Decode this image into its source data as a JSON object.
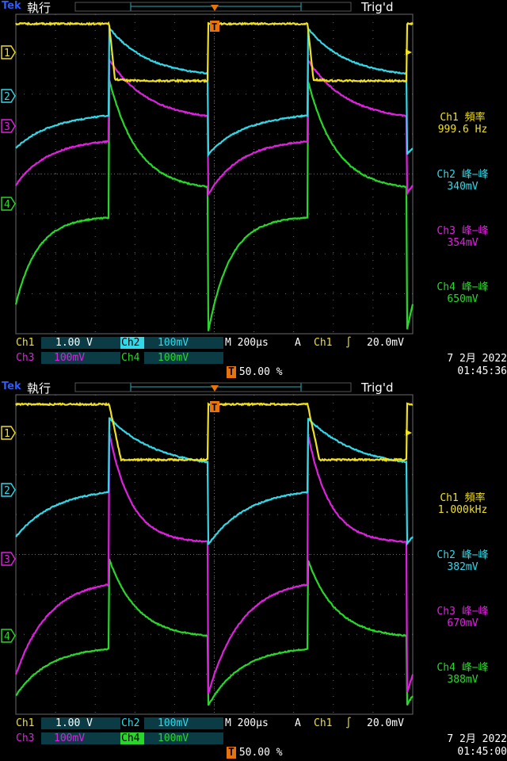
{
  "colors": {
    "ch1": "#f0e020",
    "ch2": "#30d8e8",
    "ch3": "#e020e0",
    "ch4": "#28d828",
    "grid": "#6a6a6a",
    "orange": "#e8720c"
  },
  "panels": [
    {
      "brand": "Tek",
      "run_state": "執行",
      "trigger_status": "Trig'd",
      "measurements": [
        {
          "label": "Ch1 頻率",
          "value": "999.6 Hz"
        },
        {
          "label": "Ch2 峰−峰",
          "value": "340mV"
        },
        {
          "label": "Ch3 峰−峰",
          "value": "354mV"
        },
        {
          "label": "Ch4 峰−峰",
          "value": "650mV"
        }
      ],
      "settings": {
        "ch1": "Ch1",
        "ch1_scale": "1.00 V",
        "ch2": "Ch2",
        "ch2_scale": "100mV",
        "ch3": "Ch3",
        "ch3_scale": "100mV",
        "ch4": "Ch4",
        "ch4_scale": "100mV",
        "timebase": "M 200µs",
        "coupling": "A",
        "trig_src": "Ch1",
        "trig_level": "20.0mV"
      },
      "trigger_position": "50.00 %",
      "date": "7 2月  2022",
      "time": "01:45:36",
      "markers": {
        "ch1": "1",
        "ch2": "2",
        "ch3": "3",
        "ch4": "4",
        "trig": "T"
      }
    },
    {
      "brand": "Tek",
      "run_state": "執行",
      "trigger_status": "Trig'd",
      "measurements": [
        {
          "label": "Ch1 頻率",
          "value": "1.000kHz"
        },
        {
          "label": "Ch2 峰−峰",
          "value": "382mV"
        },
        {
          "label": "Ch3 峰−峰",
          "value": "670mV"
        },
        {
          "label": "Ch4 峰−峰",
          "value": "388mV"
        }
      ],
      "settings": {
        "ch1": "Ch1",
        "ch1_scale": "1.00 V",
        "ch2": "Ch2",
        "ch2_scale": "100mV",
        "ch3": "Ch3",
        "ch3_scale": "100mV",
        "ch4": "Ch4",
        "ch4_scale": "100mV",
        "timebase": "M 200µs",
        "coupling": "A",
        "trig_src": "Ch1",
        "trig_level": "20.0mV"
      },
      "trigger_position": "50.00 %",
      "date": "7 2月  2022",
      "time": "01:45:00",
      "markers": {
        "ch1": "1",
        "ch2": "2",
        "ch3": "3",
        "ch4": "4",
        "trig": "T"
      }
    }
  ]
}
